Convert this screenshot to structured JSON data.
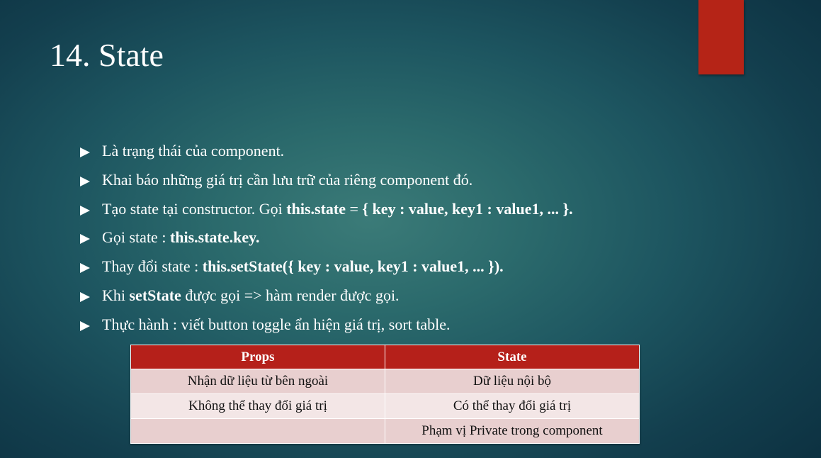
{
  "slide": {
    "title": "14. State",
    "accent_color": "#b52417",
    "bullets": [
      {
        "parts": [
          {
            "text": "Là trạng thái của component.",
            "bold": false
          }
        ]
      },
      {
        "parts": [
          {
            "text": "Khai báo những giá trị cần lưu trữ của riêng component đó.",
            "bold": false
          }
        ]
      },
      {
        "parts": [
          {
            "text": "Tạo state tại constructor. Gọi ",
            "bold": false
          },
          {
            "text": "this.state",
            "bold": true
          },
          {
            "text": " = ",
            "bold": false
          },
          {
            "text": "{ key : value, key1 : value1, ... }.",
            "bold": true
          }
        ]
      },
      {
        "parts": [
          {
            "text": "Gọi state : ",
            "bold": false
          },
          {
            "text": "this.state.key.",
            "bold": true
          }
        ]
      },
      {
        "parts": [
          {
            "text": "Thay đổi state : ",
            "bold": false
          },
          {
            "text": "this.setState({ key : value, key1 : value1, ... }).",
            "bold": true
          }
        ]
      },
      {
        "parts": [
          {
            "text": "Khi ",
            "bold": false
          },
          {
            "text": "setState",
            "bold": true
          },
          {
            "text": " được gọi => hàm render được gọi.",
            "bold": false
          }
        ]
      },
      {
        "parts": [
          {
            "text": "Thực hành : viết button toggle ẩn hiện giá trị, sort table.",
            "bold": false
          }
        ]
      }
    ],
    "table": {
      "header_color": "#b5201a",
      "headers": [
        "Props",
        "State"
      ],
      "rows": [
        [
          "Nhận dữ liệu từ bên ngoài",
          "Dữ liệu nội bộ"
        ],
        [
          "Không thể thay đổi giá trị",
          "Có thể thay đổi giá trị"
        ],
        [
          "",
          "Phạm vị Private trong component"
        ]
      ]
    }
  }
}
